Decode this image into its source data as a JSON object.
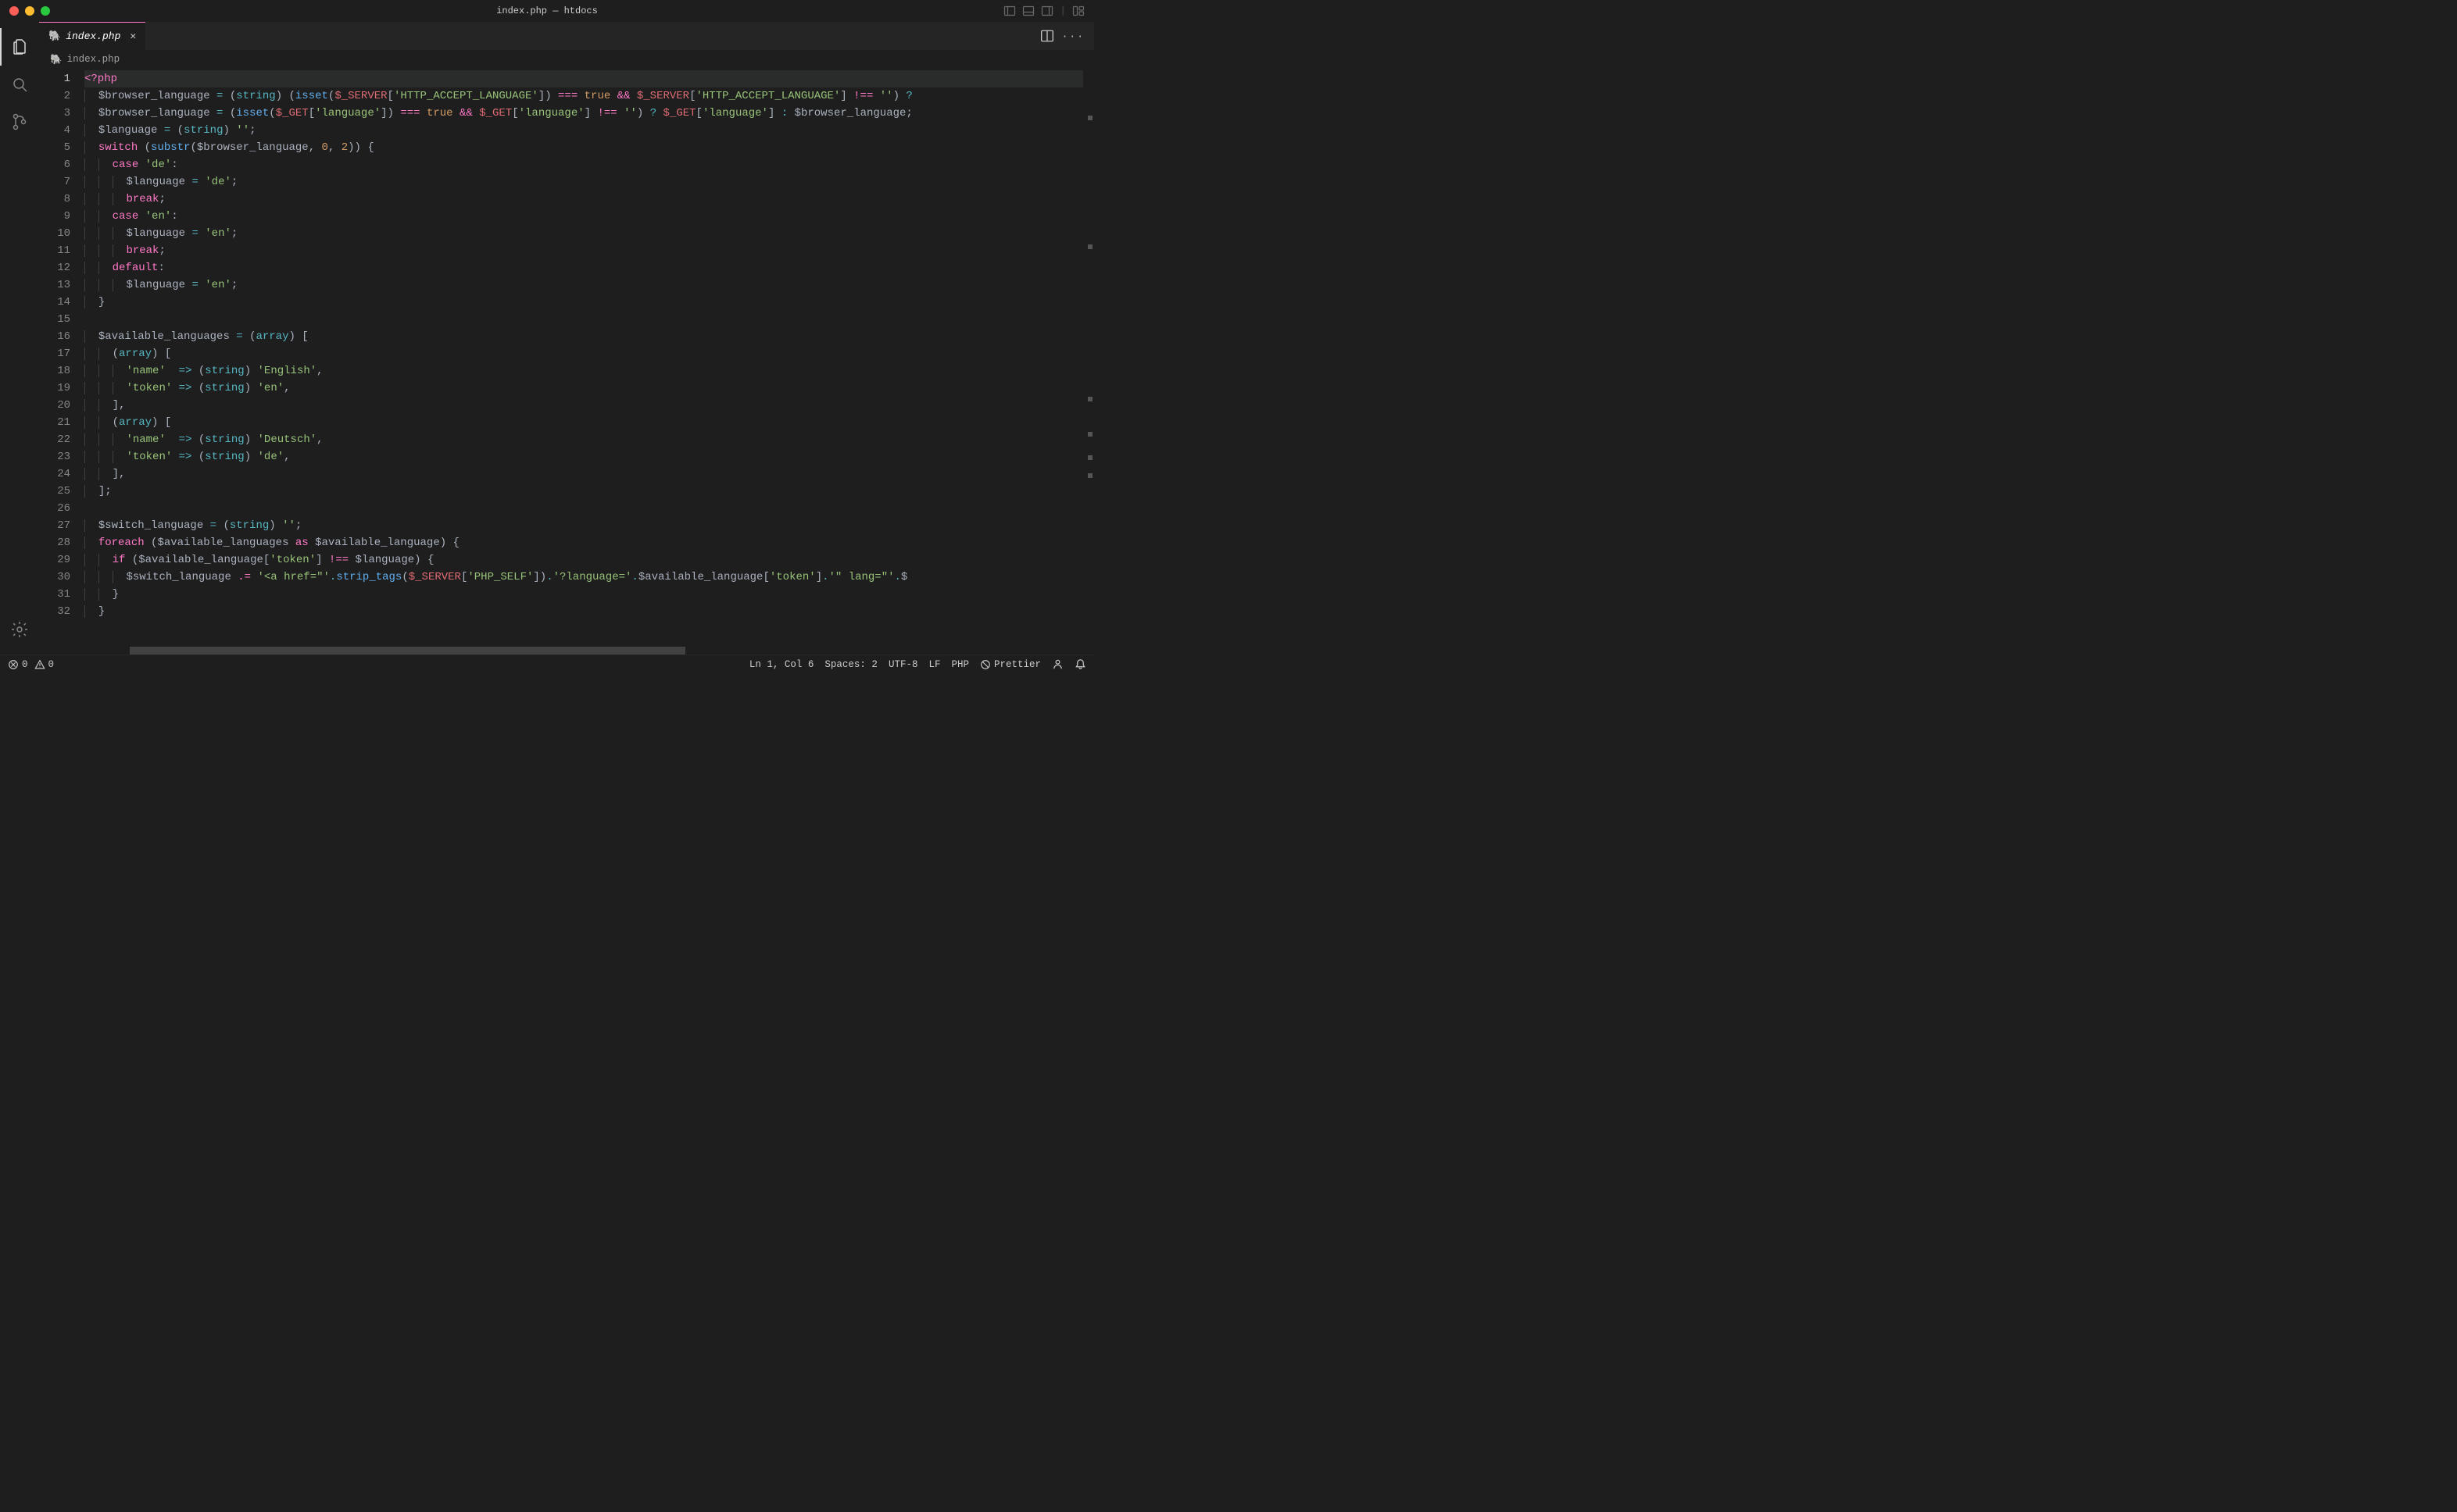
{
  "window": {
    "title": "index.php — htdocs"
  },
  "tabs": [
    {
      "icon": "🐘",
      "label": "index.php"
    }
  ],
  "breadcrumb": {
    "icon": "🐘",
    "label": "index.php"
  },
  "code": {
    "first_line": 1,
    "current_line": 1,
    "lines": [
      [
        [
          "s-tag",
          "<?php"
        ]
      ],
      [
        [
          "indent",
          1
        ],
        [
          "s-var",
          "$browser_language"
        ],
        [
          "sp",
          " "
        ],
        [
          "s-op",
          "="
        ],
        [
          "sp",
          " "
        ],
        [
          "s-punc",
          "("
        ],
        [
          "s-type",
          "string"
        ],
        [
          "s-punc",
          ")"
        ],
        [
          "sp",
          " "
        ],
        [
          "s-punc",
          "("
        ],
        [
          "s-func",
          "isset"
        ],
        [
          "s-punc",
          "("
        ],
        [
          "s-glob",
          "$_SERVER"
        ],
        [
          "s-punc",
          "["
        ],
        [
          "s-str",
          "'HTTP_ACCEPT_LANGUAGE'"
        ],
        [
          "s-punc",
          "])"
        ],
        [
          "sp",
          " "
        ],
        [
          "s-kw",
          "==="
        ],
        [
          "sp",
          " "
        ],
        [
          "s-bool",
          "true"
        ],
        [
          "sp",
          " "
        ],
        [
          "s-kw",
          "&&"
        ],
        [
          "sp",
          " "
        ],
        [
          "s-glob",
          "$_SERVER"
        ],
        [
          "s-punc",
          "["
        ],
        [
          "s-str",
          "'HTTP_ACCEPT_LANGUAGE'"
        ],
        [
          "s-punc",
          "]"
        ],
        [
          "sp",
          " "
        ],
        [
          "s-kw",
          "!=="
        ],
        [
          "sp",
          " "
        ],
        [
          "s-str",
          "''"
        ],
        [
          "s-punc",
          ")"
        ],
        [
          "sp",
          " "
        ],
        [
          "s-op",
          "?"
        ]
      ],
      [
        [
          "indent",
          1
        ],
        [
          "s-var",
          "$browser_language"
        ],
        [
          "sp",
          " "
        ],
        [
          "s-op",
          "="
        ],
        [
          "sp",
          " "
        ],
        [
          "s-punc",
          "("
        ],
        [
          "s-func",
          "isset"
        ],
        [
          "s-punc",
          "("
        ],
        [
          "s-glob",
          "$_GET"
        ],
        [
          "s-punc",
          "["
        ],
        [
          "s-str",
          "'language'"
        ],
        [
          "s-punc",
          "])"
        ],
        [
          "sp",
          " "
        ],
        [
          "s-kw",
          "==="
        ],
        [
          "sp",
          " "
        ],
        [
          "s-bool",
          "true"
        ],
        [
          "sp",
          " "
        ],
        [
          "s-kw",
          "&&"
        ],
        [
          "sp",
          " "
        ],
        [
          "s-glob",
          "$_GET"
        ],
        [
          "s-punc",
          "["
        ],
        [
          "s-str",
          "'language'"
        ],
        [
          "s-punc",
          "]"
        ],
        [
          "sp",
          " "
        ],
        [
          "s-kw",
          "!=="
        ],
        [
          "sp",
          " "
        ],
        [
          "s-str",
          "''"
        ],
        [
          "s-punc",
          ")"
        ],
        [
          "sp",
          " "
        ],
        [
          "s-op",
          "?"
        ],
        [
          "sp",
          " "
        ],
        [
          "s-glob",
          "$_GET"
        ],
        [
          "s-punc",
          "["
        ],
        [
          "s-str",
          "'language'"
        ],
        [
          "s-punc",
          "]"
        ],
        [
          "sp",
          " "
        ],
        [
          "s-op",
          ":"
        ],
        [
          "sp",
          " "
        ],
        [
          "s-var",
          "$browser_language"
        ],
        [
          "s-punc",
          ";"
        ]
      ],
      [
        [
          "indent",
          1
        ],
        [
          "s-var",
          "$language"
        ],
        [
          "sp",
          " "
        ],
        [
          "s-op",
          "="
        ],
        [
          "sp",
          " "
        ],
        [
          "s-punc",
          "("
        ],
        [
          "s-type",
          "string"
        ],
        [
          "s-punc",
          ")"
        ],
        [
          "sp",
          " "
        ],
        [
          "s-str",
          "''"
        ],
        [
          "s-punc",
          ";"
        ]
      ],
      [
        [
          "indent",
          1
        ],
        [
          "s-kw",
          "switch"
        ],
        [
          "sp",
          " "
        ],
        [
          "s-punc",
          "("
        ],
        [
          "s-func",
          "substr"
        ],
        [
          "s-punc",
          "("
        ],
        [
          "s-var",
          "$browser_language"
        ],
        [
          "s-punc",
          ","
        ],
        [
          "sp",
          " "
        ],
        [
          "s-num",
          "0"
        ],
        [
          "s-punc",
          ","
        ],
        [
          "sp",
          " "
        ],
        [
          "s-num",
          "2"
        ],
        [
          "s-punc",
          "))"
        ],
        [
          "sp",
          " "
        ],
        [
          "s-punc",
          "{"
        ]
      ],
      [
        [
          "indent",
          2
        ],
        [
          "s-kw",
          "case"
        ],
        [
          "sp",
          " "
        ],
        [
          "s-str",
          "'de'"
        ],
        [
          "s-punc",
          ":"
        ]
      ],
      [
        [
          "indent",
          3
        ],
        [
          "s-var",
          "$language"
        ],
        [
          "sp",
          " "
        ],
        [
          "s-op",
          "="
        ],
        [
          "sp",
          " "
        ],
        [
          "s-str",
          "'de'"
        ],
        [
          "s-punc",
          ";"
        ]
      ],
      [
        [
          "indent",
          3
        ],
        [
          "s-kw",
          "break"
        ],
        [
          "s-punc",
          ";"
        ]
      ],
      [
        [
          "indent",
          2
        ],
        [
          "s-kw",
          "case"
        ],
        [
          "sp",
          " "
        ],
        [
          "s-str",
          "'en'"
        ],
        [
          "s-punc",
          ":"
        ]
      ],
      [
        [
          "indent",
          3
        ],
        [
          "s-var",
          "$language"
        ],
        [
          "sp",
          " "
        ],
        [
          "s-op",
          "="
        ],
        [
          "sp",
          " "
        ],
        [
          "s-str",
          "'en'"
        ],
        [
          "s-punc",
          ";"
        ]
      ],
      [
        [
          "indent",
          3
        ],
        [
          "s-kw",
          "break"
        ],
        [
          "s-punc",
          ";"
        ]
      ],
      [
        [
          "indent",
          2
        ],
        [
          "s-kw",
          "default"
        ],
        [
          "s-punc",
          ":"
        ]
      ],
      [
        [
          "indent",
          3
        ],
        [
          "s-var",
          "$language"
        ],
        [
          "sp",
          " "
        ],
        [
          "s-op",
          "="
        ],
        [
          "sp",
          " "
        ],
        [
          "s-str",
          "'en'"
        ],
        [
          "s-punc",
          ";"
        ]
      ],
      [
        [
          "indent",
          1
        ],
        [
          "s-punc",
          "}"
        ]
      ],
      [],
      [
        [
          "indent",
          1
        ],
        [
          "s-var",
          "$available_languages"
        ],
        [
          "sp",
          " "
        ],
        [
          "s-op",
          "="
        ],
        [
          "sp",
          " "
        ],
        [
          "s-punc",
          "("
        ],
        [
          "s-type",
          "array"
        ],
        [
          "s-punc",
          ")"
        ],
        [
          "sp",
          " "
        ],
        [
          "s-punc",
          "["
        ]
      ],
      [
        [
          "indent",
          2
        ],
        [
          "s-punc",
          "("
        ],
        [
          "s-type",
          "array"
        ],
        [
          "s-punc",
          ")"
        ],
        [
          "sp",
          " "
        ],
        [
          "s-punc",
          "["
        ]
      ],
      [
        [
          "indent",
          3
        ],
        [
          "s-str",
          "'name'"
        ],
        [
          "sp",
          "  "
        ],
        [
          "s-op",
          "=>"
        ],
        [
          "sp",
          " "
        ],
        [
          "s-punc",
          "("
        ],
        [
          "s-type",
          "string"
        ],
        [
          "s-punc",
          ")"
        ],
        [
          "sp",
          " "
        ],
        [
          "s-str",
          "'English'"
        ],
        [
          "s-punc",
          ","
        ]
      ],
      [
        [
          "indent",
          3
        ],
        [
          "s-str",
          "'token'"
        ],
        [
          "sp",
          " "
        ],
        [
          "s-op",
          "=>"
        ],
        [
          "sp",
          " "
        ],
        [
          "s-punc",
          "("
        ],
        [
          "s-type",
          "string"
        ],
        [
          "s-punc",
          ")"
        ],
        [
          "sp",
          " "
        ],
        [
          "s-str",
          "'en'"
        ],
        [
          "s-punc",
          ","
        ]
      ],
      [
        [
          "indent",
          2
        ],
        [
          "s-punc",
          "],"
        ]
      ],
      [
        [
          "indent",
          2
        ],
        [
          "s-punc",
          "("
        ],
        [
          "s-type",
          "array"
        ],
        [
          "s-punc",
          ")"
        ],
        [
          "sp",
          " "
        ],
        [
          "s-punc",
          "["
        ]
      ],
      [
        [
          "indent",
          3
        ],
        [
          "s-str",
          "'name'"
        ],
        [
          "sp",
          "  "
        ],
        [
          "s-op",
          "=>"
        ],
        [
          "sp",
          " "
        ],
        [
          "s-punc",
          "("
        ],
        [
          "s-type",
          "string"
        ],
        [
          "s-punc",
          ")"
        ],
        [
          "sp",
          " "
        ],
        [
          "s-str",
          "'Deutsch'"
        ],
        [
          "s-punc",
          ","
        ]
      ],
      [
        [
          "indent",
          3
        ],
        [
          "s-str",
          "'token'"
        ],
        [
          "sp",
          " "
        ],
        [
          "s-op",
          "=>"
        ],
        [
          "sp",
          " "
        ],
        [
          "s-punc",
          "("
        ],
        [
          "s-type",
          "string"
        ],
        [
          "s-punc",
          ")"
        ],
        [
          "sp",
          " "
        ],
        [
          "s-str",
          "'de'"
        ],
        [
          "s-punc",
          ","
        ]
      ],
      [
        [
          "indent",
          2
        ],
        [
          "s-punc",
          "],"
        ]
      ],
      [
        [
          "indent",
          1
        ],
        [
          "s-punc",
          "];"
        ]
      ],
      [],
      [
        [
          "indent",
          1
        ],
        [
          "s-var",
          "$switch_language"
        ],
        [
          "sp",
          " "
        ],
        [
          "s-op",
          "="
        ],
        [
          "sp",
          " "
        ],
        [
          "s-punc",
          "("
        ],
        [
          "s-type",
          "string"
        ],
        [
          "s-punc",
          ")"
        ],
        [
          "sp",
          " "
        ],
        [
          "s-str",
          "''"
        ],
        [
          "s-punc",
          ";"
        ]
      ],
      [
        [
          "indent",
          1
        ],
        [
          "s-kw",
          "foreach"
        ],
        [
          "sp",
          " "
        ],
        [
          "s-punc",
          "("
        ],
        [
          "s-var",
          "$available_languages"
        ],
        [
          "sp",
          " "
        ],
        [
          "s-kw",
          "as"
        ],
        [
          "sp",
          " "
        ],
        [
          "s-var",
          "$available_language"
        ],
        [
          "s-punc",
          ")"
        ],
        [
          "sp",
          " "
        ],
        [
          "s-punc",
          "{"
        ]
      ],
      [
        [
          "indent",
          2
        ],
        [
          "s-kw",
          "if"
        ],
        [
          "sp",
          " "
        ],
        [
          "s-punc",
          "("
        ],
        [
          "s-var",
          "$available_language"
        ],
        [
          "s-punc",
          "["
        ],
        [
          "s-str",
          "'token'"
        ],
        [
          "s-punc",
          "]"
        ],
        [
          "sp",
          " "
        ],
        [
          "s-kw",
          "!=="
        ],
        [
          "sp",
          " "
        ],
        [
          "s-var",
          "$language"
        ],
        [
          "s-punc",
          ")"
        ],
        [
          "sp",
          " "
        ],
        [
          "s-punc",
          "{"
        ]
      ],
      [
        [
          "indent",
          3
        ],
        [
          "s-var",
          "$switch_language"
        ],
        [
          "sp",
          " "
        ],
        [
          "s-kw",
          ".="
        ],
        [
          "sp",
          " "
        ],
        [
          "s-str",
          "'<a href=\"'"
        ],
        [
          "s-op",
          "."
        ],
        [
          "s-func",
          "strip_tags"
        ],
        [
          "s-punc",
          "("
        ],
        [
          "s-glob",
          "$_SERVER"
        ],
        [
          "s-punc",
          "["
        ],
        [
          "s-str",
          "'PHP_SELF'"
        ],
        [
          "s-punc",
          "])"
        ],
        [
          "s-op",
          "."
        ],
        [
          "s-str",
          "'?language='"
        ],
        [
          "s-op",
          "."
        ],
        [
          "s-var",
          "$available_language"
        ],
        [
          "s-punc",
          "["
        ],
        [
          "s-str",
          "'token'"
        ],
        [
          "s-punc",
          "]"
        ],
        [
          "s-op",
          "."
        ],
        [
          "s-str",
          "'\" lang=\"'"
        ],
        [
          "s-op",
          "."
        ],
        [
          "s-var",
          "$"
        ]
      ],
      [
        [
          "indent",
          2
        ],
        [
          "s-punc",
          "}"
        ]
      ],
      [
        [
          "indent",
          1
        ],
        [
          "s-punc",
          "}"
        ]
      ]
    ]
  },
  "status": {
    "errors": "0",
    "warnings": "0",
    "ln_col": "Ln 1, Col 6",
    "spaces": "Spaces: 2",
    "encoding": "UTF-8",
    "eol": "LF",
    "lang": "PHP",
    "prettier": "Prettier"
  }
}
